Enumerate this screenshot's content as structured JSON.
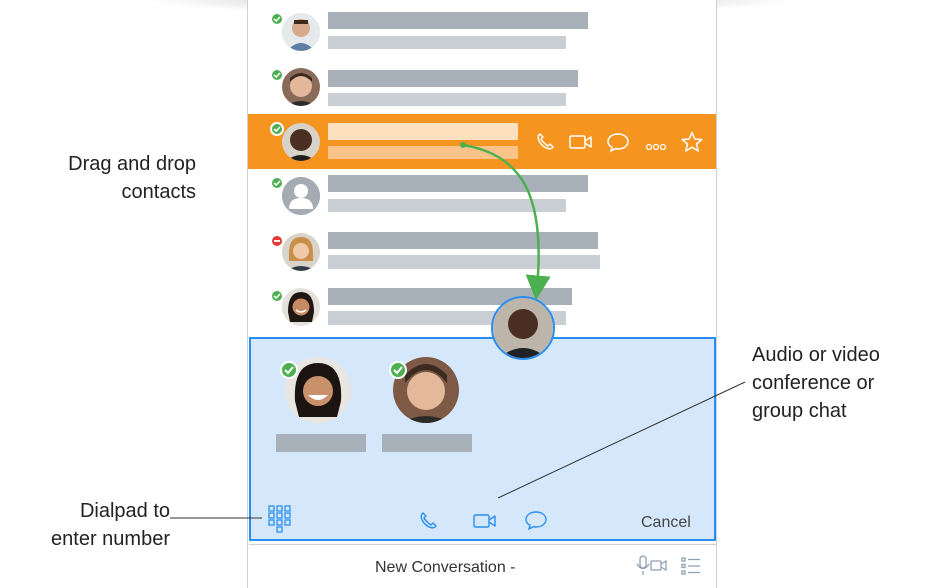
{
  "annotations": {
    "drag_drop": [
      "Drag and drop",
      "contacts"
    ],
    "conference": [
      "Audio or video",
      "conference or",
      "group chat"
    ],
    "dialpad": [
      "Dialpad to",
      "enter number"
    ]
  },
  "drop_zone": {
    "cancel_label": "Cancel"
  },
  "bottom_bar": {
    "title": "New Conversation -"
  },
  "icons": {
    "call": "phone-icon",
    "video": "video-icon",
    "chat": "chat-bubble-icon",
    "more": "more-icon",
    "favorite": "star-icon",
    "dialpad": "dialpad-icon",
    "mic_video": "mic-video-icon",
    "list": "list-icon"
  },
  "colors": {
    "selected_row": "#f5951f",
    "drop_zone_fill": "#d5e8fb",
    "drop_zone_border": "#2a8ef0",
    "presence_available": "#4caf50",
    "presence_busy": "#e53935",
    "drag_arrow": "#4caf50"
  },
  "contacts": [
    {
      "presence": "available"
    },
    {
      "presence": "available"
    },
    {
      "presence": "available",
      "selected": true
    },
    {
      "presence": "available"
    },
    {
      "presence": "busy"
    },
    {
      "presence": "available"
    }
  ],
  "conference_participants": [
    {
      "presence": "available"
    },
    {
      "presence": "available"
    }
  ]
}
